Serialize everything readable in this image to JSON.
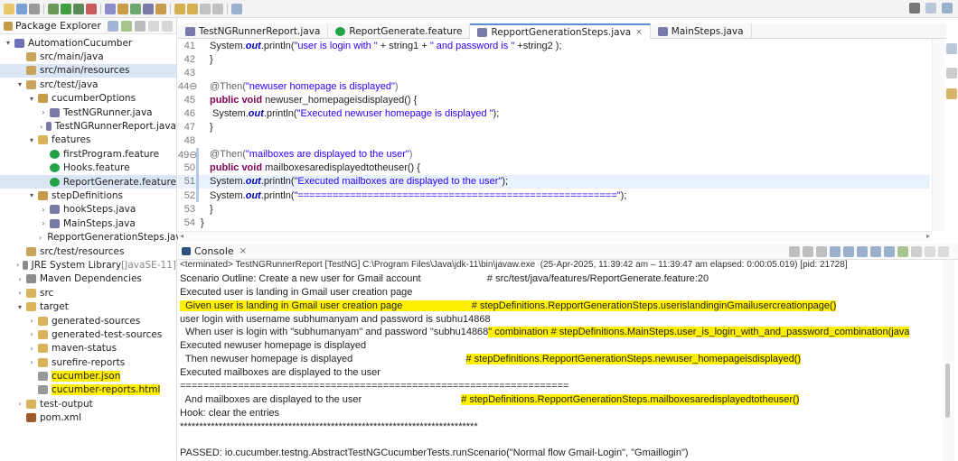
{
  "toolbar": {
    "icons": [
      "new-file-icon",
      "save-icon",
      "print-icon",
      "debug-icon",
      "run-icon",
      "run-coverage-icon",
      "external-tools-icon",
      "new-java-project-icon",
      "new-package-icon",
      "new-class-icon",
      "open-type-icon",
      "search-icon",
      "next-annotation-icon",
      "prev-annotation-icon",
      "back-icon",
      "forward-icon",
      "pin-editor-icon"
    ],
    "right_icons": [
      "search-icon",
      "perspective-java-icon",
      "perspective-debug-icon"
    ]
  },
  "package_explorer": {
    "title": "Package Explorer",
    "items": [
      {
        "depth": 0,
        "twisty": "v",
        "label": "AutomationCucumber",
        "icon": "project-icon",
        "color": "#6f6fb5"
      },
      {
        "depth": 1,
        "twisty": "",
        "label": "src/main/java",
        "icon": "source-folder-icon",
        "color": "#c8a45c"
      },
      {
        "depth": 1,
        "twisty": "",
        "label": "src/main/resources",
        "icon": "source-folder-icon",
        "color": "#c8a45c",
        "selected": true
      },
      {
        "depth": 1,
        "twisty": "v",
        "label": "src/test/java",
        "icon": "source-folder-icon",
        "color": "#c8a45c"
      },
      {
        "depth": 2,
        "twisty": "v",
        "label": "cucumberOptions",
        "icon": "package-icon",
        "color": "#c59b4a"
      },
      {
        "depth": 3,
        "twisty": ">",
        "label": "TestNGRunner.java",
        "icon": "java-file-icon",
        "color": "#7a7aa6"
      },
      {
        "depth": 3,
        "twisty": ">",
        "label": "TestNGRunnerReport.java",
        "icon": "java-file-icon",
        "color": "#7a7aa6"
      },
      {
        "depth": 2,
        "twisty": "v",
        "label": "features",
        "icon": "folder-icon",
        "color": "#d9b45b"
      },
      {
        "depth": 3,
        "twisty": "",
        "label": "firstProgram.feature",
        "icon": "cucumber-icon",
        "color": "#23a248"
      },
      {
        "depth": 3,
        "twisty": "",
        "label": "Hooks.feature",
        "icon": "cucumber-icon",
        "color": "#23a248"
      },
      {
        "depth": 3,
        "twisty": "",
        "label": "ReportGenerate.feature",
        "icon": "cucumber-icon",
        "color": "#23a248",
        "selected": true
      },
      {
        "depth": 2,
        "twisty": "v",
        "label": "stepDefinitions",
        "icon": "package-icon",
        "color": "#c59b4a"
      },
      {
        "depth": 3,
        "twisty": ">",
        "label": "hookSteps.java",
        "icon": "java-file-icon",
        "color": "#7a7aa6"
      },
      {
        "depth": 3,
        "twisty": ">",
        "label": "MainSteps.java",
        "icon": "java-file-icon",
        "color": "#7a7aa6"
      },
      {
        "depth": 3,
        "twisty": ">",
        "label": "RepportGenerationSteps.java",
        "icon": "java-file-icon",
        "color": "#7a7aa6"
      },
      {
        "depth": 1,
        "twisty": "",
        "label": "src/test/resources",
        "icon": "source-folder-icon",
        "color": "#c8a45c"
      },
      {
        "depth": 1,
        "twisty": ">",
        "label": "JRE System Library",
        "decor": "[JavaSE-11]",
        "icon": "library-icon",
        "color": "#8b8b8b"
      },
      {
        "depth": 1,
        "twisty": ">",
        "label": "Maven Dependencies",
        "icon": "library-icon",
        "color": "#8b8b8b"
      },
      {
        "depth": 1,
        "twisty": ">",
        "label": "src",
        "icon": "folder-icon",
        "color": "#d9b45b"
      },
      {
        "depth": 1,
        "twisty": "v",
        "label": "target",
        "icon": "folder-icon",
        "color": "#d9b45b"
      },
      {
        "depth": 2,
        "twisty": ">",
        "label": "generated-sources",
        "icon": "folder-icon",
        "color": "#d9b45b"
      },
      {
        "depth": 2,
        "twisty": ">",
        "label": "generated-test-sources",
        "icon": "folder-icon",
        "color": "#d9b45b"
      },
      {
        "depth": 2,
        "twisty": ">",
        "label": "maven-status",
        "icon": "folder-icon",
        "color": "#d9b45b"
      },
      {
        "depth": 2,
        "twisty": ">",
        "label": "surefire-reports",
        "icon": "folder-icon",
        "color": "#d9b45b"
      },
      {
        "depth": 2,
        "twisty": "",
        "label": "cucumber.json",
        "icon": "json-file-icon",
        "color": "#999999",
        "highlight": true
      },
      {
        "depth": 2,
        "twisty": "",
        "label": "cucumber-reports.html",
        "icon": "html-file-icon",
        "color": "#999999",
        "highlight": true
      },
      {
        "depth": 1,
        "twisty": ">",
        "label": "test-output",
        "icon": "folder-icon",
        "color": "#d9b45b"
      },
      {
        "depth": 1,
        "twisty": "",
        "label": "pom.xml",
        "icon": "xml-file-icon",
        "color": "#a05a2c"
      }
    ]
  },
  "editor": {
    "tabs": [
      {
        "label": "TestNGRunnerReport.java",
        "icon": "java-file-icon",
        "active": false,
        "closable": false
      },
      {
        "label": "ReportGenerate.feature",
        "icon": "cucumber-icon",
        "active": false,
        "closable": false
      },
      {
        "label": "RepportGenerationSteps.java",
        "icon": "java-file-icon",
        "active": true,
        "closable": true
      },
      {
        "label": "MainSteps.java",
        "icon": "java-file-icon",
        "active": false,
        "closable": false
      }
    ],
    "close_glyph": "×",
    "lines": [
      {
        "n": "41",
        "mark": false,
        "cur": false,
        "parts": [
          {
            "t": "System.",
            "c": ""
          },
          {
            "t": "out",
            "c": "ital"
          },
          {
            "t": ".println(",
            "c": ""
          },
          {
            "t": "\"user is login with \"",
            "c": "str"
          },
          {
            "t": " + string1 + ",
            "c": ""
          },
          {
            "t": "\" and password is \"",
            "c": "str"
          },
          {
            "t": " +string2 );",
            "c": ""
          }
        ]
      },
      {
        "n": "42",
        "mark": false,
        "cur": false,
        "parts": [
          {
            "t": "}",
            "c": ""
          }
        ]
      },
      {
        "n": "43",
        "mark": false,
        "cur": false,
        "parts": []
      },
      {
        "n": "44⊖",
        "mark": false,
        "cur": false,
        "parts": [
          {
            "t": "@Then(",
            "c": "ann"
          },
          {
            "t": "\"newuser homepage is displayed\"",
            "c": "str"
          },
          {
            "t": ")",
            "c": "ann"
          }
        ]
      },
      {
        "n": "45",
        "mark": false,
        "cur": false,
        "parts": [
          {
            "t": "public void",
            "c": "kw"
          },
          {
            "t": " newuser_homepageisdisplayed() {",
            "c": ""
          }
        ]
      },
      {
        "n": "46",
        "mark": false,
        "cur": false,
        "parts": [
          {
            "t": " System.",
            "c": ""
          },
          {
            "t": "out",
            "c": "ital"
          },
          {
            "t": ".println(",
            "c": ""
          },
          {
            "t": "\"Executed newuser homepage is displayed \"",
            "c": "str"
          },
          {
            "t": ");",
            "c": ""
          }
        ]
      },
      {
        "n": "47",
        "mark": false,
        "cur": false,
        "parts": [
          {
            "t": "}",
            "c": ""
          }
        ]
      },
      {
        "n": "48",
        "mark": false,
        "cur": false,
        "parts": []
      },
      {
        "n": "49⊖",
        "mark": true,
        "cur": false,
        "parts": [
          {
            "t": "@Then(",
            "c": "ann"
          },
          {
            "t": "\"mailboxes are displayed to the user\"",
            "c": "str"
          },
          {
            "t": ")",
            "c": "ann"
          }
        ]
      },
      {
        "n": "50",
        "mark": true,
        "cur": false,
        "parts": [
          {
            "t": "public void",
            "c": "kw"
          },
          {
            "t": " mailboxesaredisplayedtotheuser() {",
            "c": ""
          }
        ]
      },
      {
        "n": "51",
        "mark": true,
        "cur": true,
        "parts": [
          {
            "t": "System.",
            "c": ""
          },
          {
            "t": "out",
            "c": "ital"
          },
          {
            "t": ".println(",
            "c": ""
          },
          {
            "t": "\"Executed mailboxes are displayed to the user\"",
            "c": "str"
          },
          {
            "t": ");",
            "c": ""
          }
        ]
      },
      {
        "n": "52",
        "mark": true,
        "cur": false,
        "parts": [
          {
            "t": "System.",
            "c": ""
          },
          {
            "t": "out",
            "c": "ital"
          },
          {
            "t": ".println(",
            "c": ""
          },
          {
            "t": "\"=======================================================\"",
            "c": "str"
          },
          {
            "t": ");",
            "c": ""
          }
        ]
      },
      {
        "n": "53",
        "mark": false,
        "cur": false,
        "parts": [
          {
            "t": "}",
            "c": ""
          }
        ]
      },
      {
        "n": "54",
        "mark": false,
        "cur": false,
        "parts": [
          {
            "t": "}",
            "c": "",
            "indent": false
          }
        ]
      }
    ]
  },
  "console": {
    "title": "Console",
    "close_glyph": "×",
    "terminated": "<terminated> TestNGRunnerReport [TestNG] C:\\Program Files\\Java\\jdk-11\\bin\\javaw.exe  (25-Apr-2025, 11:39:42 am – 11:39:47 am elapsed: 0:00:05.019) [pid: 21728]",
    "lines": [
      {
        "segs": [
          {
            "t": "Scenario Outline: Create a new user for Gmail account                        # src/test/java/features/ReportGenerate.feature:20",
            "hl": false
          }
        ]
      },
      {
        "segs": [
          {
            "t": "Executed user is landing in Gmail user creation page",
            "hl": false
          }
        ]
      },
      {
        "segs": [
          {
            "t": "  Given user is landing in Gmail user creation page                         # stepDefinitions.RepportGenerationSteps.userislandinginGmailusercreationpage()",
            "hl": true
          }
        ]
      },
      {
        "segs": [
          {
            "t": "user login with username subhumanyam and password is subhu14868",
            "hl": false
          }
        ]
      },
      {
        "segs": [
          {
            "t": "  When user is login with \"subhumanyam\" and password \"subhu14868",
            "hl": false
          },
          {
            "t": "\" combination # stepDefinitions.MainSteps.user_is_login_with_and_password_combination(java",
            "hl": true
          }
        ]
      },
      {
        "segs": [
          {
            "t": "Executed newuser homepage is displayed",
            "hl": false
          }
        ]
      },
      {
        "segs": [
          {
            "t": "  Then newuser homepage is displayed                                         ",
            "hl": false
          },
          {
            "t": "# stepDefinitions.RepportGenerationSteps.newuser_homepageisdisplayed()",
            "hl": true
          }
        ]
      },
      {
        "segs": [
          {
            "t": "Executed mailboxes are displayed to the user",
            "hl": false
          }
        ]
      },
      {
        "segs": [
          {
            "t": "===================================================================",
            "hl": false
          }
        ]
      },
      {
        "segs": [
          {
            "t": "  And mailboxes are displayed to the user                                    ",
            "hl": false
          },
          {
            "t": "# stepDefinitions.RepportGenerationSteps.mailboxesaredisplayedtotheuser()",
            "hl": true
          }
        ]
      },
      {
        "segs": [
          {
            "t": "Hook: clear the entries",
            "hl": false
          }
        ]
      },
      {
        "segs": [
          {
            "t": "*****************************************************************************",
            "hl": false
          }
        ]
      },
      {
        "segs": [
          {
            "t": "",
            "hl": false
          }
        ]
      },
      {
        "segs": [
          {
            "t": "PASSED: io.cucumber.testng.AbstractTestNGCucumberTests.runScenario(\"Normal flow Gmail-Login\", \"Gmaillogin\")",
            "hl": false
          }
        ]
      }
    ]
  }
}
